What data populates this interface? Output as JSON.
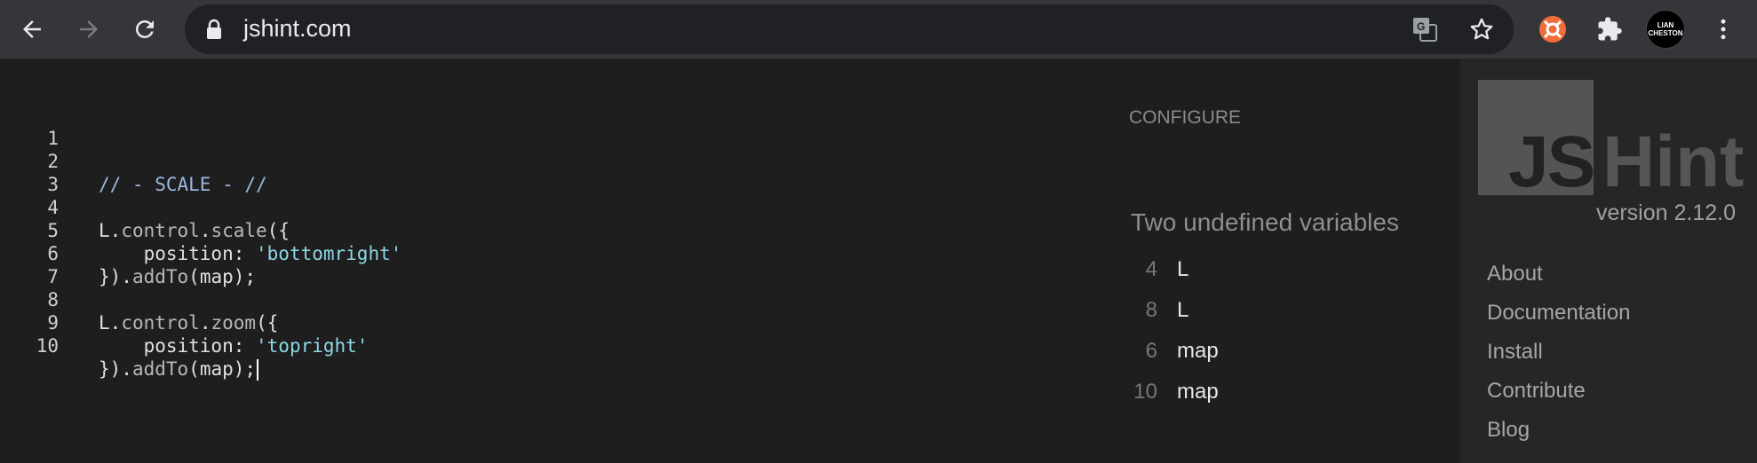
{
  "browser": {
    "url": "jshint.com",
    "profile_initials": [
      "LIAN",
      "CHESTON"
    ],
    "accent_colors": {
      "extension_orange": "#f26c3a"
    }
  },
  "editor": {
    "lines": [
      {
        "n": "1",
        "code": ""
      },
      {
        "n": "2",
        "code": "// - SCALE - //"
      },
      {
        "n": "3",
        "code": ""
      },
      {
        "n": "4",
        "obj": "L",
        "dot1": ".",
        "prop1": "control",
        "dot2": ".",
        "prop2": "scale",
        "rest": "({"
      },
      {
        "n": "5",
        "indent": "    ",
        "key": "position: ",
        "str": "'bottomright'"
      },
      {
        "n": "6",
        "pre": "})",
        "dot": ".",
        "method": "addTo",
        "rest": "(map);"
      },
      {
        "n": "7",
        "code": ""
      },
      {
        "n": "8",
        "obj": "L",
        "dot1": ".",
        "prop1": "control",
        "dot2": ".",
        "prop2": "zoom",
        "rest": "({"
      },
      {
        "n": "9",
        "indent": "    ",
        "key": "position: ",
        "str": "'topright'"
      },
      {
        "n": "10",
        "pre": "})",
        "dot": ".",
        "method": "addTo",
        "rest": "(map);"
      }
    ]
  },
  "report": {
    "configure_label": "CONFIGURE",
    "title": "Two undefined variables",
    "errors": [
      {
        "line": "4",
        "var": "L"
      },
      {
        "line": "8",
        "var": "L"
      },
      {
        "line": "6",
        "var": "map"
      },
      {
        "line": "10",
        "var": "map"
      }
    ]
  },
  "sidebar": {
    "logo_js": "JS",
    "logo_hint": "Hint",
    "version": "version 2.12.0",
    "nav": [
      "About",
      "Documentation",
      "Install",
      "Contribute",
      "Blog"
    ]
  }
}
